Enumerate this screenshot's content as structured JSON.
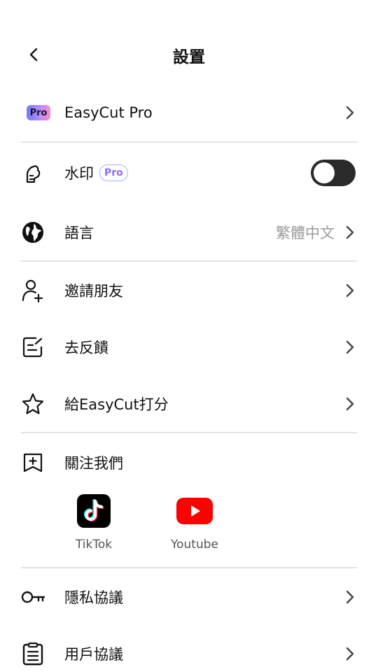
{
  "header": {
    "title": "設置"
  },
  "items": {
    "pro": {
      "label": "EasyCut Pro",
      "badge": "Pro"
    },
    "watermark": {
      "label": "水印",
      "badge": "Pro",
      "enabled": false
    },
    "language": {
      "label": "語言",
      "value": "繁體中文"
    },
    "invite": {
      "label": "邀請朋友"
    },
    "feedback": {
      "label": "去反饋"
    },
    "rate": {
      "label": "給EasyCut打分"
    },
    "follow": {
      "label": "關注我們"
    },
    "privacy": {
      "label": "隱私協議"
    },
    "user_agreement": {
      "label": "用戶協議"
    }
  },
  "social": [
    {
      "name": "TikTok",
      "icon": "tiktok-icon"
    },
    {
      "name": "Youtube",
      "icon": "youtube-icon"
    }
  ],
  "colors": {
    "toggle_off": "#2a2a2a",
    "youtube_red": "#ff0000",
    "pro_gradient_start": "#6f7bff",
    "pro_gradient_end": "#ff8ac8"
  }
}
